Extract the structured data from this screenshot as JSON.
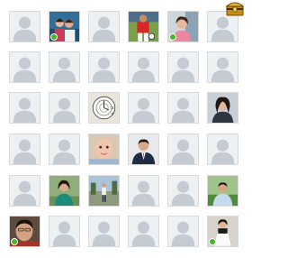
{
  "grid": {
    "cropped_heading": "",
    "rows": [
      [
        "default",
        "photo-group-portrait",
        "default",
        "photo-soccer-player",
        "photo-woman-pink",
        "default"
      ],
      [
        "default",
        "default",
        "default",
        "default",
        "default",
        "default"
      ],
      [
        "default",
        "default",
        "photo-surreal-clock",
        "default",
        "default",
        "photo-woman-portrait"
      ],
      [
        "default",
        "default",
        "photo-baby",
        "photo-man-suit",
        "default",
        "default"
      ],
      [
        "default",
        "photo-woman-outdoor",
        "photo-person-street",
        "default",
        "default",
        "photo-man-outdoor"
      ],
      [
        "photo-man-closeup",
        "default",
        "default",
        "default",
        "default",
        "photo-woman-white-dress"
      ]
    ],
    "online": [
      [
        0,
        1
      ],
      [
        0,
        4
      ],
      [
        5,
        0
      ],
      [
        5,
        5
      ]
    ]
  },
  "badge": {
    "icon": "treasure-chest-icon",
    "color": "#d8a21a"
  },
  "colors": {
    "placeholder_bg": "#eef1f4",
    "silhouette": "#c4cbd3",
    "online": "#42b72a"
  }
}
